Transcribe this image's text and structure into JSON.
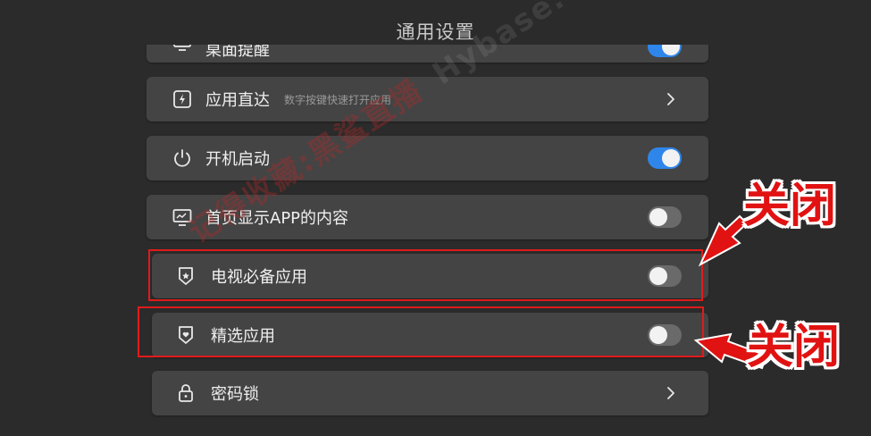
{
  "title": "通用设置",
  "rows": [
    {
      "label": "桌面提醒",
      "sub": "",
      "control": "toggle",
      "state": "on"
    },
    {
      "label": "应用直达",
      "sub": "数字按键快速打开应用",
      "control": "chevron"
    },
    {
      "label": "开机启动",
      "sub": "",
      "control": "toggle",
      "state": "on"
    },
    {
      "label": "首页显示APP的内容",
      "sub": "",
      "control": "toggle",
      "state": "off"
    },
    {
      "label": "电视必备应用",
      "sub": "",
      "control": "toggle",
      "state": "off"
    },
    {
      "label": "精选应用",
      "sub": "",
      "control": "toggle",
      "state": "off"
    },
    {
      "label": "密码锁",
      "sub": "",
      "control": "chevron"
    }
  ],
  "annotations": {
    "close_1": "关闭",
    "close_2": "关闭"
  },
  "watermark": {
    "cn": "记得收藏:黑鲨直播",
    "en": "Hybase.com"
  },
  "colors": {
    "accent": "#2f86ea",
    "annotation": "#e11212",
    "row_bg": "#444444",
    "page_bg": "#2b2b2b"
  }
}
